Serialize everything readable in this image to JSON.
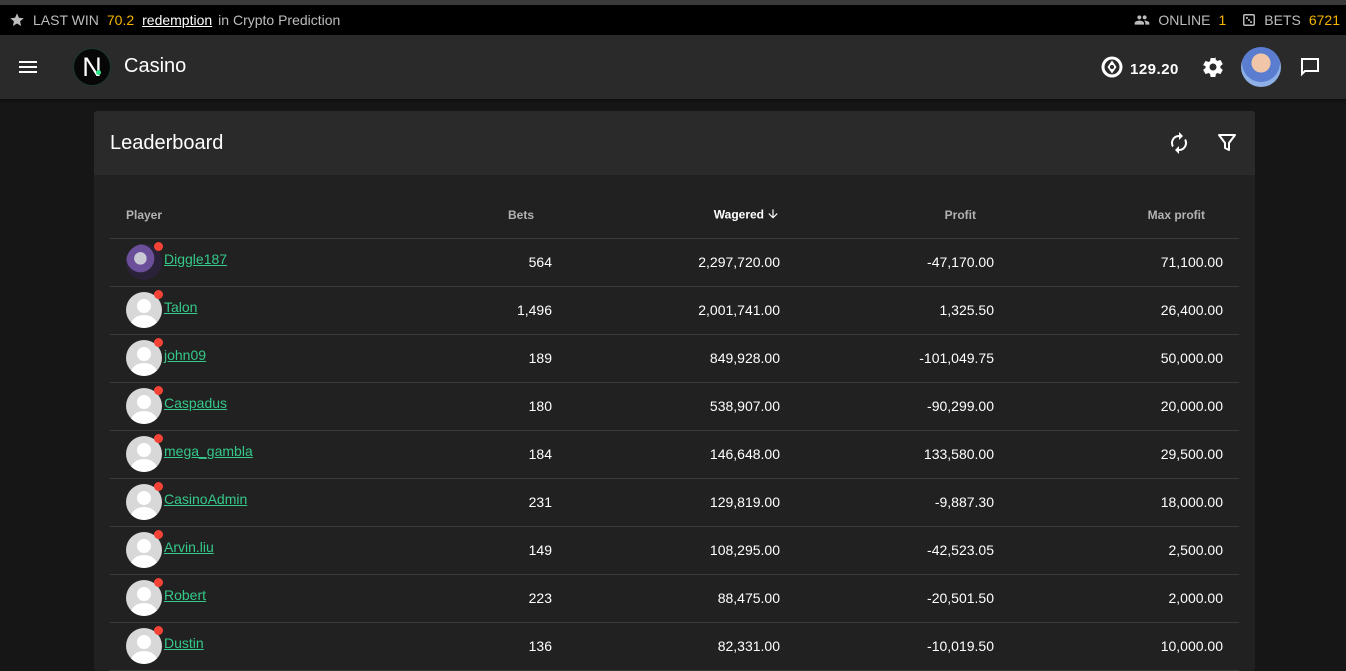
{
  "ticker": {
    "last_win_label": "LAST WIN",
    "last_win_amount": "70.2",
    "last_win_user": "redemption",
    "last_win_game": "in Crypto Prediction",
    "online_label": "ONLINE",
    "online_count": "1",
    "bets_label": "BETS",
    "bets_count": "6721"
  },
  "header": {
    "logo_letter": "N",
    "title": "Casino",
    "balance": "129.20"
  },
  "leaderboard": {
    "title": "Leaderboard",
    "columns": [
      "Player",
      "Bets",
      "Wagered",
      "Profit",
      "Max profit"
    ],
    "sorted_column": "Wagered",
    "rows": [
      {
        "player": "Diggle187",
        "bets": "564",
        "wagered": "2,297,720.00",
        "profit": "-47,170.00",
        "max_profit": "71,100.00",
        "avatar": "custom"
      },
      {
        "player": "Talon",
        "bets": "1,496",
        "wagered": "2,001,741.00",
        "profit": "1,325.50",
        "max_profit": "26,400.00",
        "avatar": "default"
      },
      {
        "player": "john09",
        "bets": "189",
        "wagered": "849,928.00",
        "profit": "-101,049.75",
        "max_profit": "50,000.00",
        "avatar": "default"
      },
      {
        "player": "Caspadus",
        "bets": "180",
        "wagered": "538,907.00",
        "profit": "-90,299.00",
        "max_profit": "20,000.00",
        "avatar": "default"
      },
      {
        "player": "mega_gambla",
        "bets": "184",
        "wagered": "146,648.00",
        "profit": "133,580.00",
        "max_profit": "29,500.00",
        "avatar": "default"
      },
      {
        "player": "CasinoAdmin",
        "bets": "231",
        "wagered": "129,819.00",
        "profit": "-9,887.30",
        "max_profit": "18,000.00",
        "avatar": "default"
      },
      {
        "player": "Arvin.liu",
        "bets": "149",
        "wagered": "108,295.00",
        "profit": "-42,523.05",
        "max_profit": "2,500.00",
        "avatar": "default"
      },
      {
        "player": "Robert",
        "bets": "223",
        "wagered": "88,475.00",
        "profit": "-20,501.50",
        "max_profit": "2,000.00",
        "avatar": "default"
      },
      {
        "player": "Dustin",
        "bets": "136",
        "wagered": "82,331.00",
        "profit": "-10,019.50",
        "max_profit": "10,000.00",
        "avatar": "default"
      }
    ]
  },
  "colors": {
    "accent_link": "#35c98a",
    "ticker_value": "#f5b400",
    "status_dot": "#f44336"
  },
  "icons": [
    "star-icon",
    "users-icon",
    "dice-icon",
    "menu-icon",
    "chip-icon",
    "gear-icon",
    "chat-icon",
    "refresh-icon",
    "filter-icon",
    "arrow-down-icon"
  ]
}
